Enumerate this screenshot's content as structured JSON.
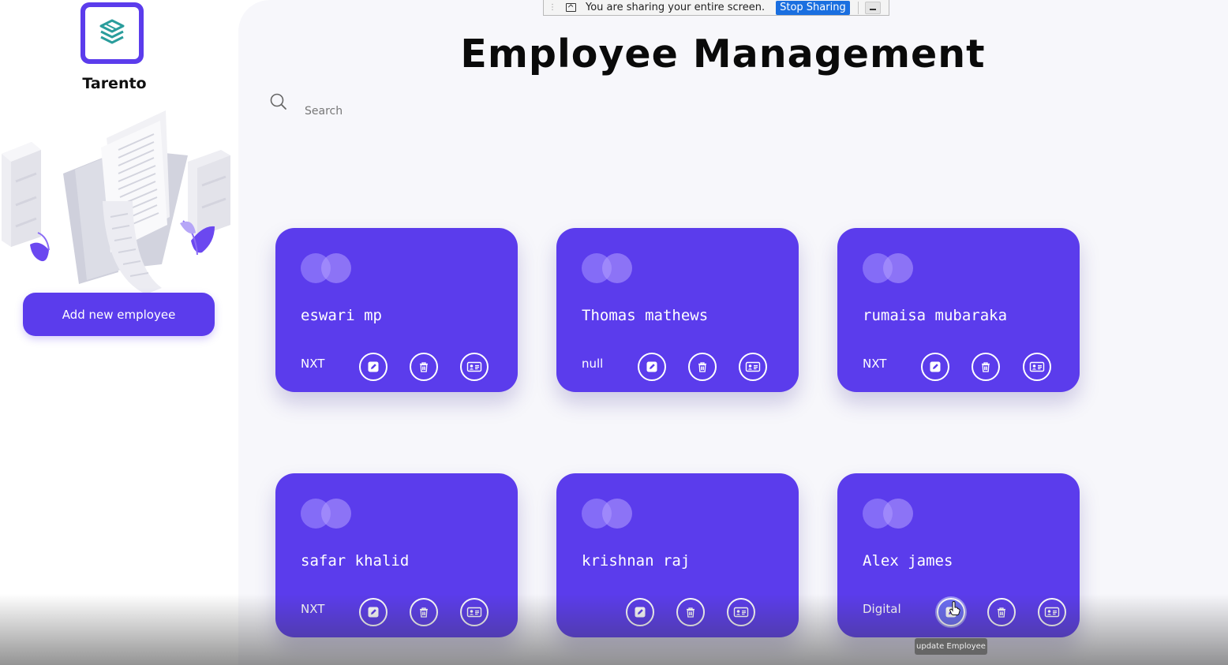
{
  "share_bar": {
    "message": "You are sharing your entire screen.",
    "stop_label": "Stop Sharing"
  },
  "sidebar": {
    "brand": "Tarento",
    "add_button_label": "Add new employee"
  },
  "header": {
    "title": "Employee Management"
  },
  "search": {
    "placeholder": "Search"
  },
  "actions": {
    "edit": "edit-icon",
    "delete": "trash-icon",
    "view": "id-card-icon"
  },
  "employees": [
    {
      "name": "eswari mp",
      "department": "NXT"
    },
    {
      "name": "Thomas mathews",
      "department": "null"
    },
    {
      "name": "rumaisa mubaraka",
      "department": "NXT"
    },
    {
      "name": "safar khalid",
      "department": "NXT"
    },
    {
      "name": "krishnan raj",
      "department": ""
    },
    {
      "name": "Alex james",
      "department": "Digital"
    }
  ],
  "tooltip": "update Employee",
  "colors": {
    "accent": "#5b3cec",
    "background": "#f7f7fb"
  }
}
